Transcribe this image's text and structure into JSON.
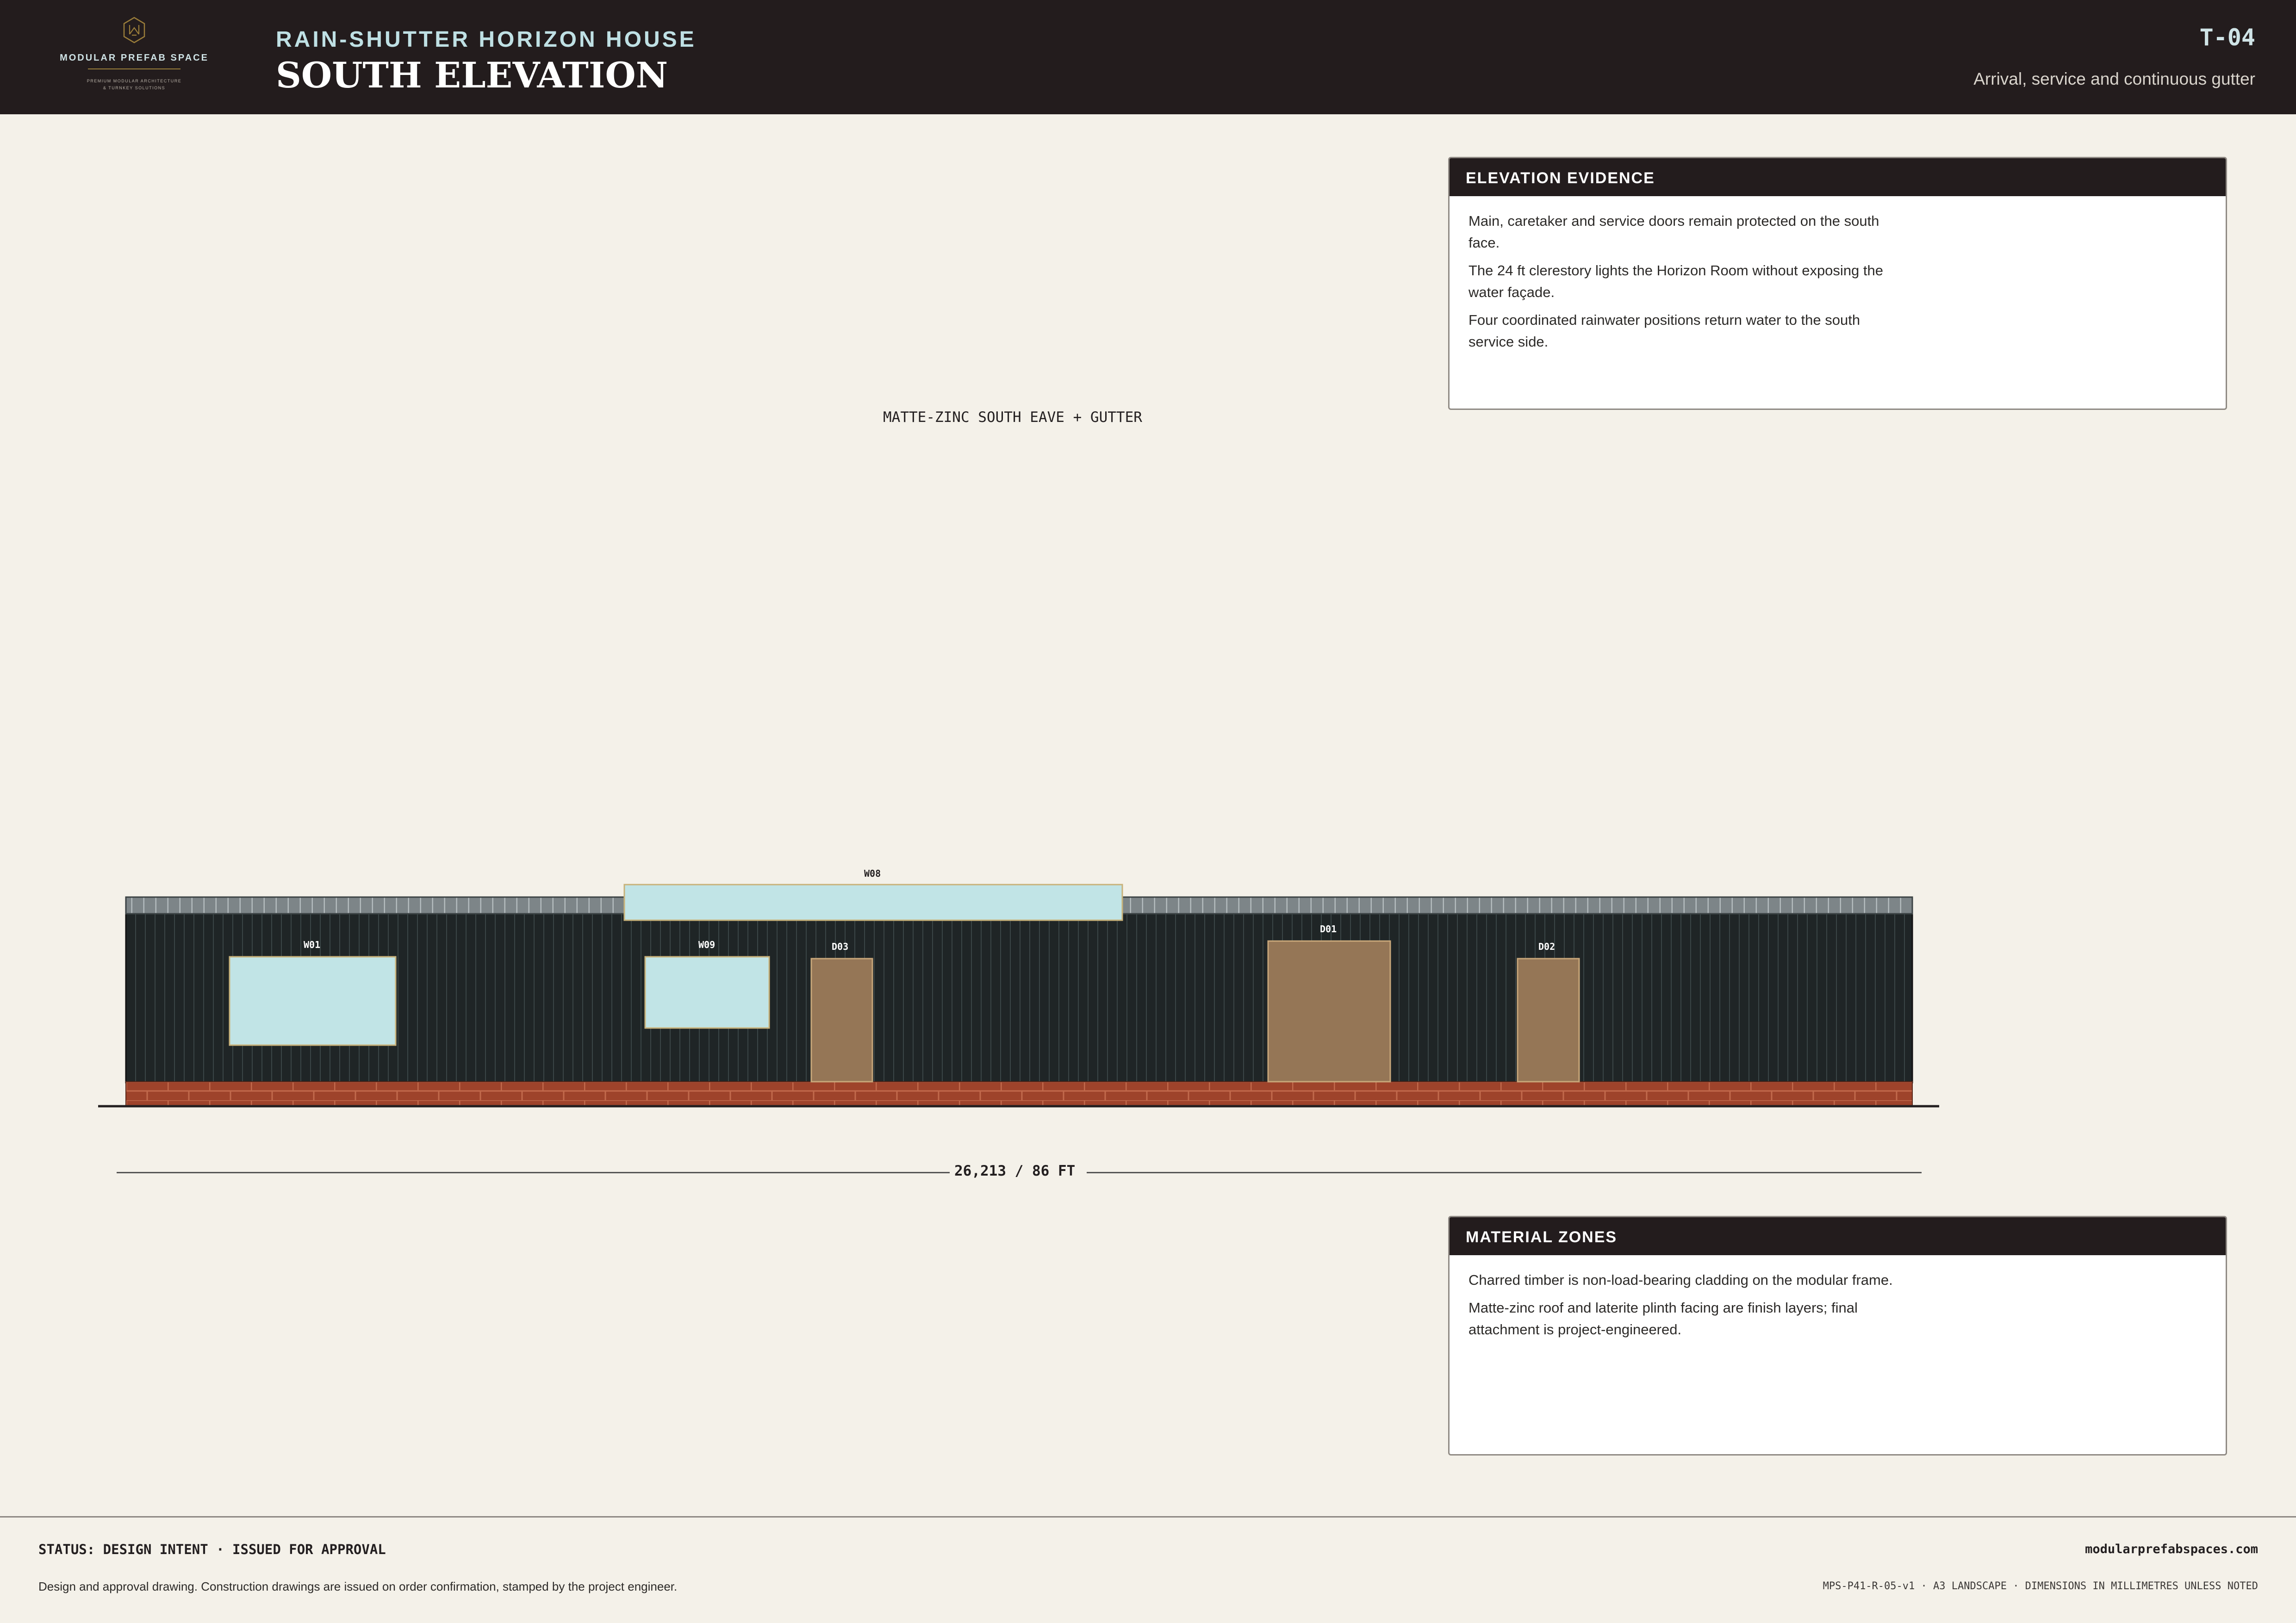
{
  "brand": {
    "name": "MODULAR PREFAB SPACE",
    "tagline_1": "PREMIUM MODULAR ARCHITECTURE",
    "tagline_2": "& TURNKEY SOLUTIONS",
    "icon": "hexagon-monogram-icon",
    "accent": "#9a7d3a"
  },
  "header": {
    "project": "RAIN-SHUTTER HORIZON HOUSE",
    "title": "SOUTH ELEVATION",
    "sheet_code": "T-04",
    "subtitle": "Arrival, service and continuous gutter"
  },
  "elevation_evidence": {
    "heading": "ELEVATION EVIDENCE",
    "notes": [
      "Main, caretaker and service doors remain protected on the south face.",
      "The 24 ft clerestory lights the Horizon Room without exposing the water façade.",
      "Four coordinated rainwater positions return water to the south service side."
    ]
  },
  "material_zones": {
    "heading": "MATERIAL ZONES",
    "notes": [
      "Charred timber is non-load-bearing cladding on the modular frame.",
      "Matte-zinc roof and laterite plinth facing are finish layers; final attachment is project-engineered."
    ]
  },
  "drawing": {
    "eave_label": "MATTE-ZINC SOUTH EAVE + GUTTER",
    "overall_dimension": "26,213 / 86 FT",
    "tags": {
      "w01": "W01",
      "w09": "W09",
      "w08": "W08",
      "d03": "D03",
      "d01": "D01",
      "d02": "D02"
    },
    "colors": {
      "cladding": "#1f2526",
      "glazing": "#c1e4e6",
      "door": "#957656",
      "plinth": "#9e432b",
      "roof": "#7d8588",
      "frame_outline": "#c8b27a"
    }
  },
  "footer": {
    "status": "STATUS: DESIGN INTENT · ISSUED FOR APPROVAL",
    "disclaimer": "Design and approval drawing. Construction drawings are issued on order confirmation, stamped by the project engineer.",
    "website": "modularprefabspaces.com",
    "reference": "MPS-P41-R-05-v1 · A3 LANDSCAPE · DIMENSIONS IN MILLIMETRES UNLESS NOTED"
  }
}
